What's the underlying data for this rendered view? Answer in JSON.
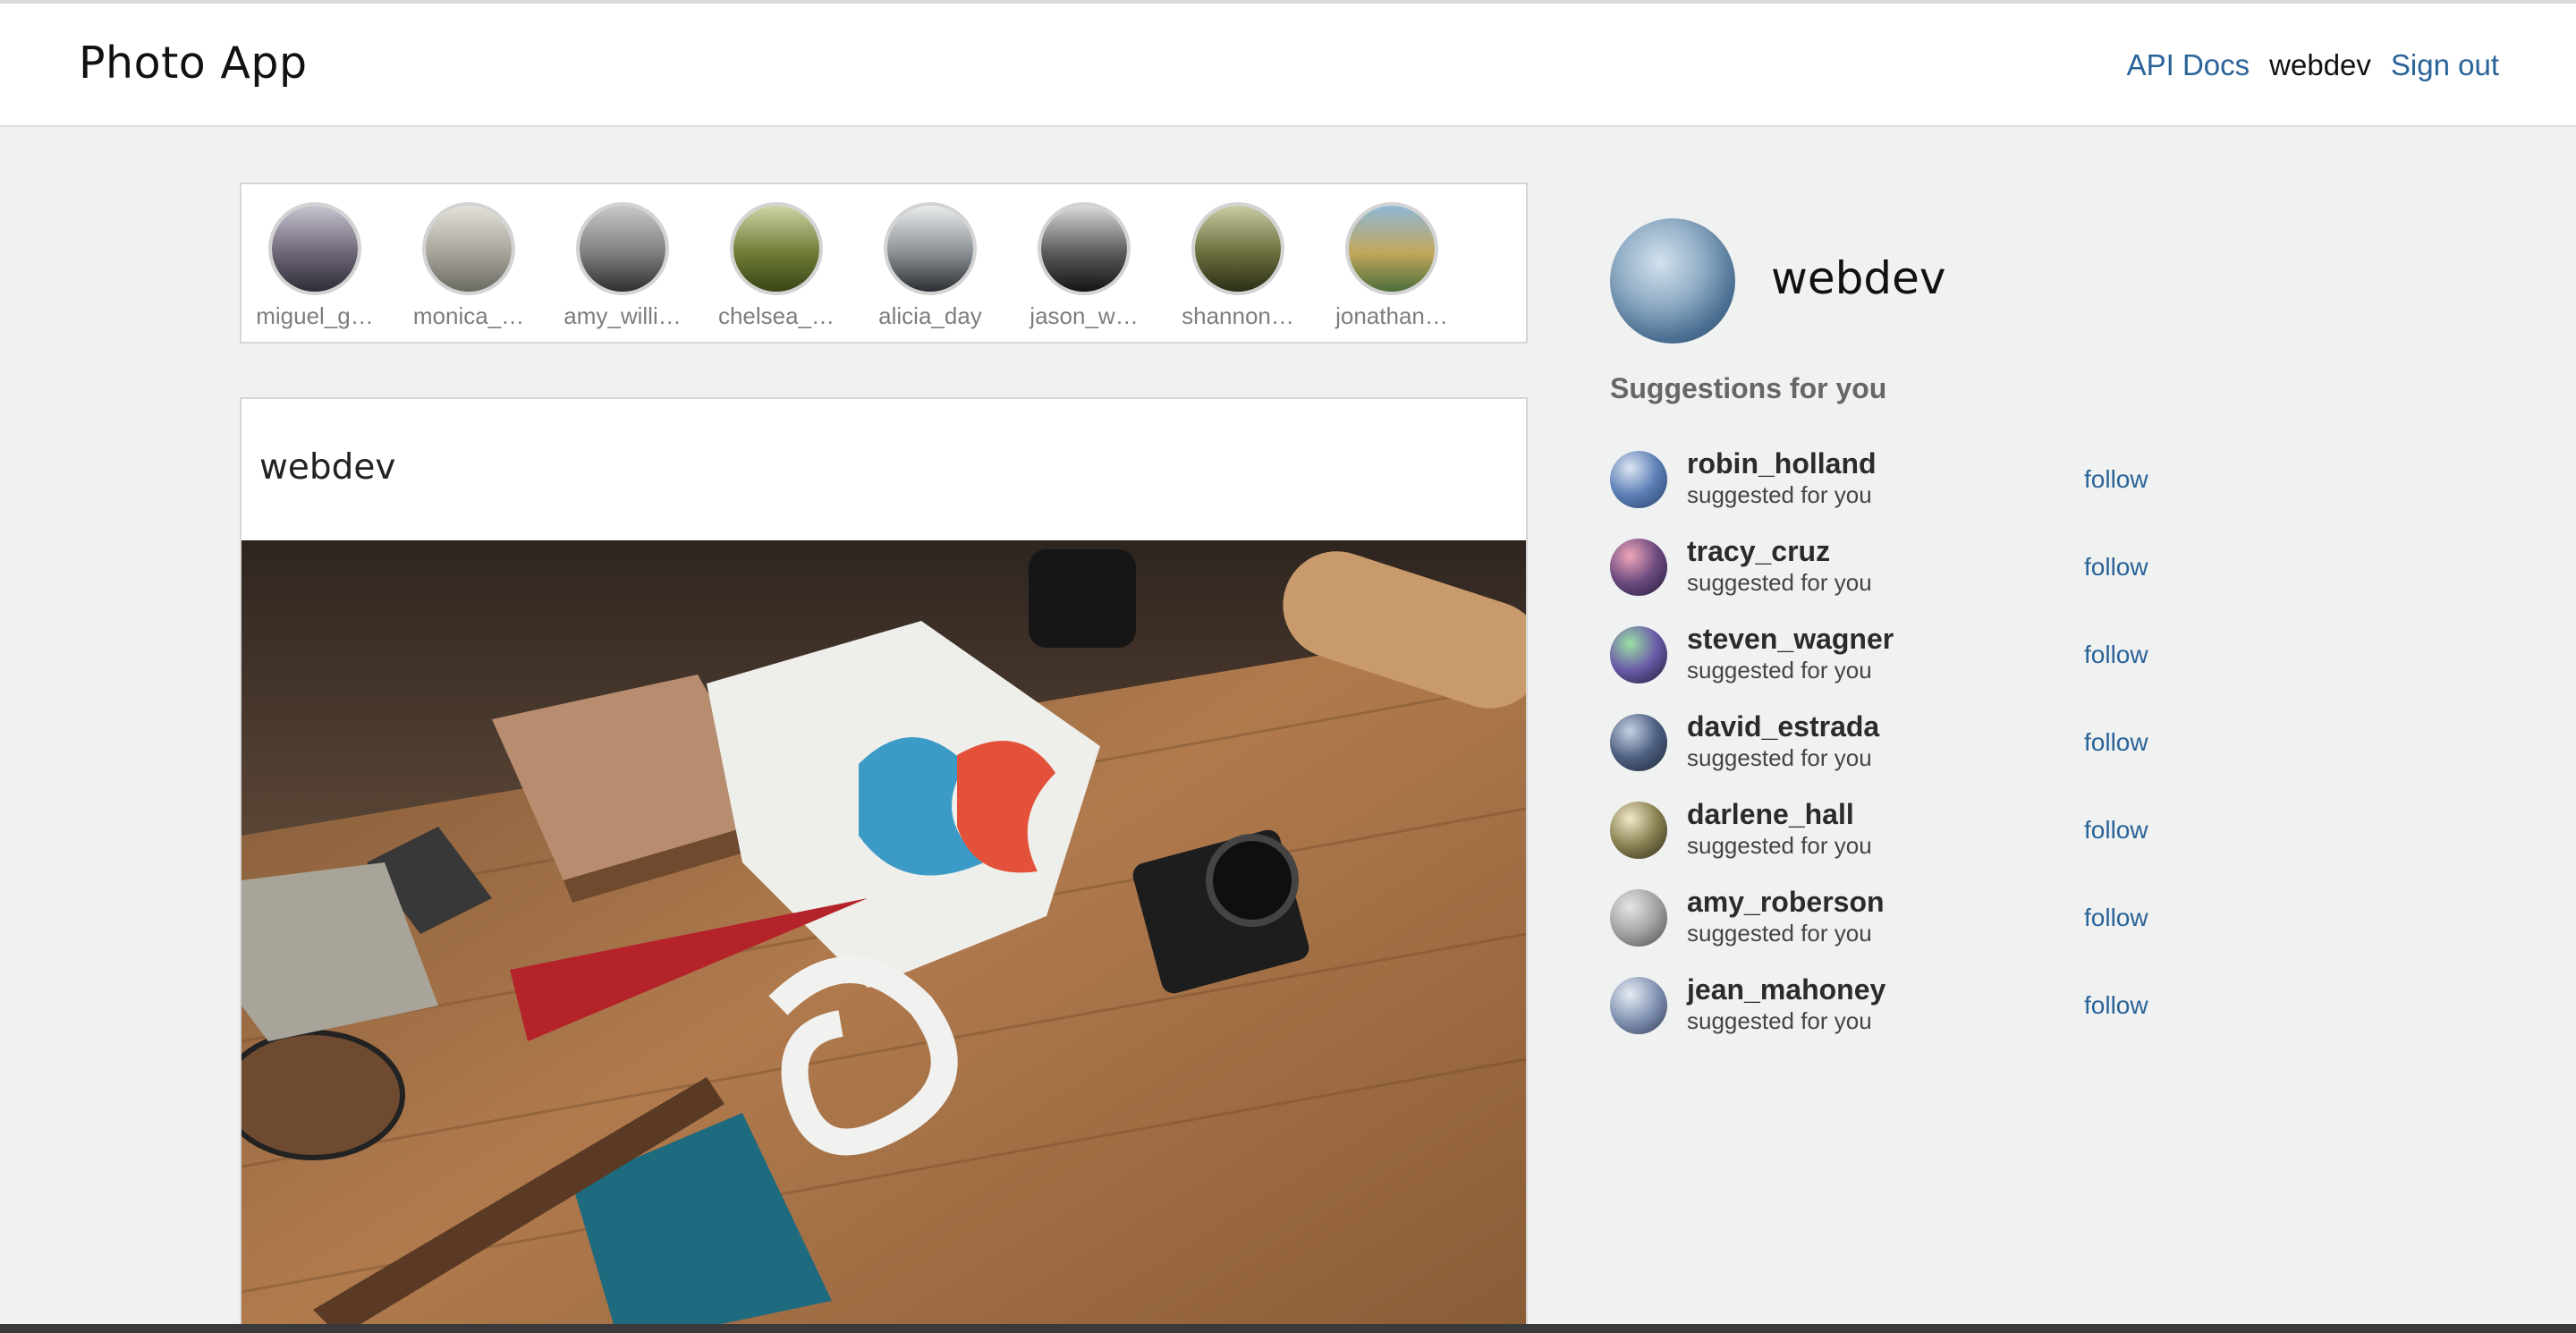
{
  "app": {
    "title": "Photo App"
  },
  "nav": {
    "api_docs": "API Docs",
    "current_user": "webdev",
    "sign_out": "Sign out"
  },
  "stories": [
    {
      "name": "miguel_g…",
      "colors": [
        "#c7c4cf",
        "#6e6678",
        "#2f2c36"
      ]
    },
    {
      "name": "monica_…",
      "colors": [
        "#e2e0d8",
        "#a7a59b",
        "#6b6a62"
      ]
    },
    {
      "name": "amy_willi…",
      "colors": [
        "#c9c9c9",
        "#7f7f7f",
        "#2e2e2e"
      ]
    },
    {
      "name": "chelsea_…",
      "colors": [
        "#cfd3a6",
        "#6e7c34",
        "#3a4519"
      ]
    },
    {
      "name": "alicia_day",
      "colors": [
        "#e9ebec",
        "#8a9094",
        "#2b2f33"
      ]
    },
    {
      "name": "jason_w…",
      "colors": [
        "#d8d8d8",
        "#5a5a5a",
        "#141414"
      ]
    },
    {
      "name": "shannon…",
      "colors": [
        "#c9cba1",
        "#6a6e3d",
        "#2c2e18"
      ]
    },
    {
      "name": "jonathan…",
      "colors": [
        "#8fb7d6",
        "#c1a75a",
        "#4c6d3a"
      ]
    }
  ],
  "post": {
    "username": "webdev"
  },
  "profile": {
    "username": "webdev"
  },
  "suggestions": {
    "title": "Suggestions for you",
    "items": [
      {
        "username": "robin_holland",
        "subtitle": "suggested for you",
        "action": "follow",
        "colors": [
          "#dde6f2",
          "#5d7fb6",
          "#263e6a"
        ]
      },
      {
        "username": "tracy_cruz",
        "subtitle": "suggested for you",
        "action": "follow",
        "colors": [
          "#f0a7ba",
          "#6c4a7e",
          "#1f1a3b"
        ]
      },
      {
        "username": "steven_wagner",
        "subtitle": "suggested for you",
        "action": "follow",
        "colors": [
          "#9be0a5",
          "#6a5aa8",
          "#1a1c33"
        ]
      },
      {
        "username": "david_estrada",
        "subtitle": "suggested for you",
        "action": "follow",
        "colors": [
          "#c5d2e4",
          "#4d5f80",
          "#1c2535"
        ]
      },
      {
        "username": "darlene_hall",
        "subtitle": "suggested for you",
        "action": "follow",
        "colors": [
          "#f1e8c9",
          "#8a8152",
          "#2d2a17"
        ]
      },
      {
        "username": "amy_roberson",
        "subtitle": "suggested for you",
        "action": "follow",
        "colors": [
          "#e5e5e5",
          "#a3a3a3",
          "#4a4a4a"
        ]
      },
      {
        "username": "jean_mahoney",
        "subtitle": "suggested for you",
        "action": "follow",
        "colors": [
          "#e7ecf3",
          "#8394b3",
          "#2e3a56"
        ]
      }
    ]
  }
}
